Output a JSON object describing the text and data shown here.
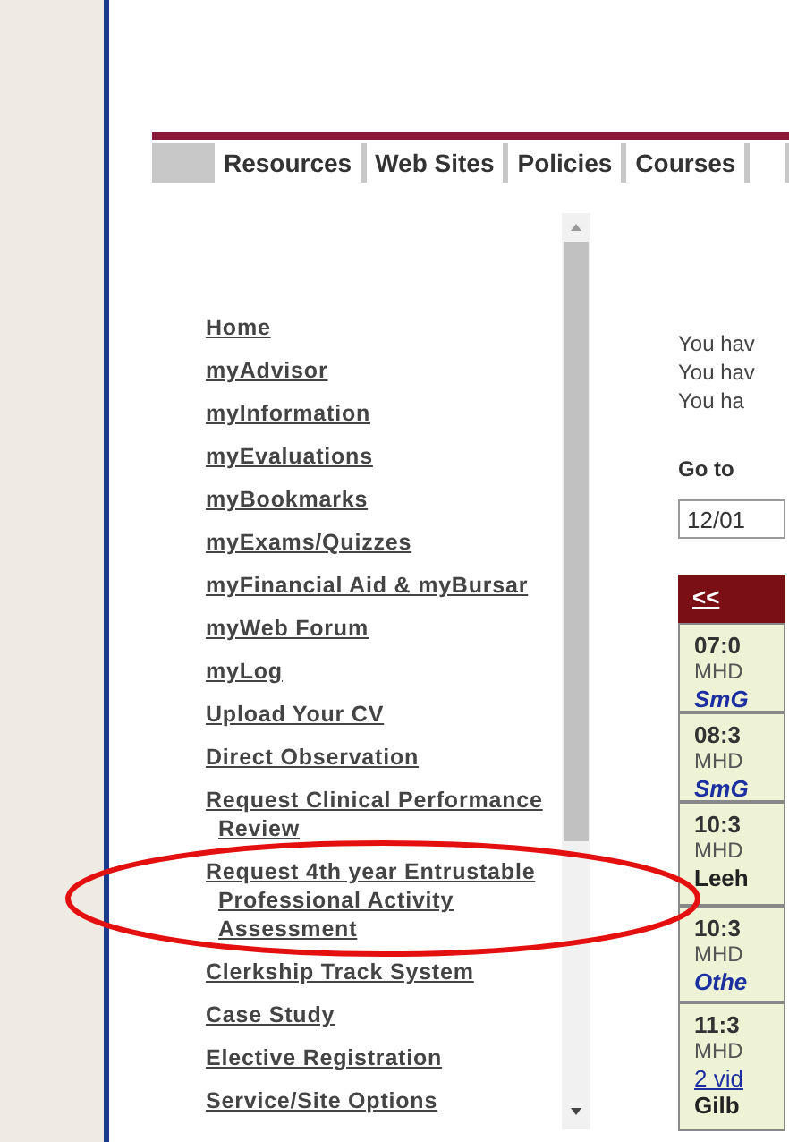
{
  "tabs": [
    {
      "label": "Resources"
    },
    {
      "label": "Web Sites"
    },
    {
      "label": "Policies"
    },
    {
      "label": "Courses"
    }
  ],
  "sidebar": {
    "links": [
      "Home",
      "myAdvisor",
      "myInformation",
      "myEvaluations",
      "myBookmarks",
      "myExams/Quizzes",
      "myFinancial Aid & myBursar",
      "myWeb Forum",
      "myLog",
      "Upload Your CV",
      "Direct Observation",
      "Request Clinical Performance Review",
      "Request 4th year Entrustable Professional Activity Assessment",
      "Clerkship Track System",
      "Case Study",
      "Elective Registration",
      "Service/Site Options"
    ]
  },
  "messages": [
    "You hav",
    "You hav",
    "You ha"
  ],
  "goto": {
    "label": "Go to",
    "value": "12/01"
  },
  "calendar": {
    "nav_link": "<<",
    "entries": [
      {
        "lines": [
          {
            "kind": "time",
            "text": "07:0"
          },
          {
            "kind": "location",
            "text": "MHD"
          },
          {
            "kind": "course",
            "text": "SmG"
          }
        ]
      },
      {
        "lines": [
          {
            "kind": "time",
            "text": "08:3"
          },
          {
            "kind": "location",
            "text": "MHD"
          },
          {
            "kind": "course",
            "text": "SmG"
          }
        ]
      },
      {
        "lines": [
          {
            "kind": "time",
            "text": "10:3"
          },
          {
            "kind": "location",
            "text": "MHD"
          },
          {
            "kind": "name",
            "text": "Leeh"
          }
        ]
      },
      {
        "lines": [
          {
            "kind": "time",
            "text": "10:3"
          },
          {
            "kind": "location",
            "text": "MHD"
          },
          {
            "kind": "course",
            "text": "Othe"
          }
        ]
      },
      {
        "lines": [
          {
            "kind": "time",
            "text": "11:3"
          },
          {
            "kind": "location",
            "text": "MHD"
          },
          {
            "kind": "link",
            "text": "2 vid"
          },
          {
            "kind": "name",
            "text": "Gilb"
          }
        ]
      }
    ]
  }
}
